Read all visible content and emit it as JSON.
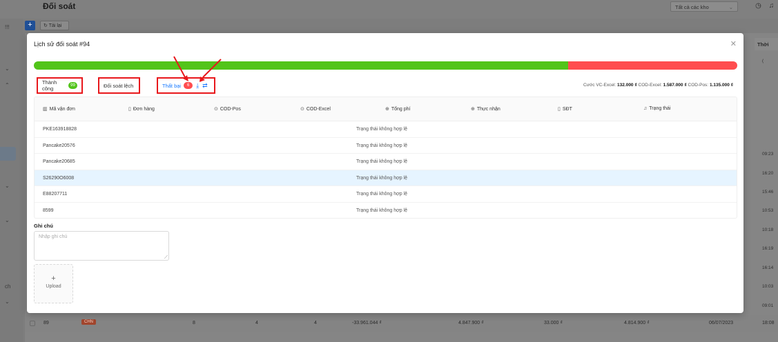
{
  "app": {
    "title": "Đối soát",
    "warehouse_select": "Tất cả các kho",
    "reload_label": "Tải lại",
    "add_label": "+",
    "right_column_header": "Thời",
    "right_times": [
      "09:23",
      "16:20",
      "15:46",
      "10:53",
      "10:18",
      "16:19",
      "16:14",
      "10:03",
      "09:01",
      "18:08"
    ],
    "sidebar_marks": [
      "!!!",
      "⌄",
      "⌃",
      "⌄",
      "⌄",
      "ch",
      "⌄"
    ],
    "bg_row": {
      "id": "89",
      "chip": "CHN",
      "col1": "8",
      "col2": "4",
      "col3": "4",
      "col4": "-33.961.044 ₫",
      "col5": "4.847.900 ₫",
      "col6": "33.000 ₫",
      "col7": "4.814.900 ₫",
      "col8": "06/07/2023",
      "col9": "18:08"
    }
  },
  "modal": {
    "title": "Lịch sử đối soát #94",
    "close_icon": "close-icon",
    "progress_success_fraction": 0.76,
    "tabs": {
      "success_label": "Thành công",
      "success_count": "99",
      "deviation_label": "Đối soát lệch",
      "fail_label": "Thất bại",
      "fail_count": "6"
    },
    "summary": {
      "vc_excel_label": "Cước VC-Excel:",
      "vc_excel_value": "132.000 ₫",
      "cod_excel_label": "COD-Excel:",
      "cod_excel_value": "1.587.000 ₫",
      "cod_pos_label": "COD-Pos:",
      "cod_pos_value": "1.135.000 ₫"
    },
    "table": {
      "headers": [
        "Mã vận đơn",
        "Đơn hàng",
        "COD-Pos",
        "COD-Excel",
        "Tổng phí",
        "Thực nhận",
        "SĐT",
        "Trạng thái"
      ],
      "rows": [
        {
          "code": "PKE163918828",
          "status": "Trạng thái không hợp lệ"
        },
        {
          "code": "Pancake20576",
          "status": "Trạng thái không hợp lệ"
        },
        {
          "code": "Pancake20685",
          "status": "Trạng thái không hợp lệ"
        },
        {
          "code": "S26290O6008",
          "status": "Trạng thái không hợp lệ"
        },
        {
          "code": "E88207711",
          "status": "Trạng thái không hợp lệ"
        },
        {
          "code": "8599",
          "status": "Trạng thái không hợp lệ"
        }
      ]
    },
    "note_label": "Ghi chú",
    "note_placeholder": "Nhập ghi chú",
    "upload_plus": "+",
    "upload_label": "Upload"
  },
  "colors": {
    "success": "#52c41a",
    "fail": "#ff4d4f",
    "link": "#1677ff",
    "annotation": "#e8171b",
    "row_highlight": "#e6f4ff"
  }
}
